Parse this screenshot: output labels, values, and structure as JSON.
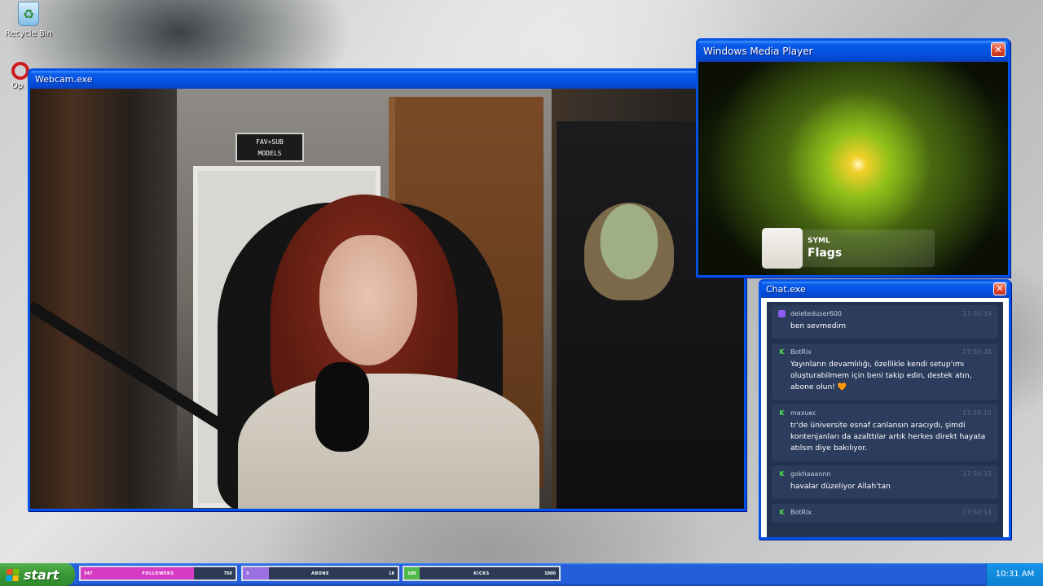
{
  "desktop": {
    "icons": [
      {
        "label": "Recycle Bin"
      },
      {
        "label": "Op"
      }
    ]
  },
  "webcam": {
    "title": "Webcam.exe",
    "sign": [
      "FAV+SUB",
      "MODELS"
    ]
  },
  "mediaplayer": {
    "title": "Windows Media Player",
    "artist": "SYML",
    "track": "Flags",
    "close": "✕"
  },
  "chat": {
    "title": "Chat.exe",
    "close": "✕",
    "messages": [
      {
        "platform": "twitch",
        "user": "deleteduser600",
        "time": "17:50:54",
        "text": "ben sevmedim"
      },
      {
        "platform": "kick",
        "user": "BotRix",
        "time": "17:50:28",
        "text": "Yayınların devamlılığı, özellikle kendi setup'ımı oluşturabilmem için beni takip edin, destek atın, abone olun! 🧡"
      },
      {
        "platform": "kick",
        "user": "maxuec",
        "time": "17:50:15",
        "text": "tr'de üniversite esnaf canlansın aracıydı, şimdi kontenjanları da azalttılar artık herkes direkt hayata atılsın diye bakılıyor."
      },
      {
        "platform": "kick",
        "user": "gokhaaannn",
        "time": "17:50:15",
        "text": "havalar düzeliyor Allah'tan"
      },
      {
        "platform": "kick",
        "user": "BotRix",
        "time": "17:50:14",
        "text": ""
      }
    ]
  },
  "taskbar": {
    "start_label": "start",
    "clock": "10:31 AM",
    "goals": [
      {
        "current": "547",
        "label": "FOLLOWERS",
        "max": "750",
        "progress": 0.73,
        "color": "#d63cc4"
      },
      {
        "current": "3",
        "label": "ABONE",
        "max": "18",
        "progress": 0.17,
        "color": "#9a6fe0"
      },
      {
        "current": "100",
        "label": "KICKS",
        "max": "1000",
        "progress": 0.1,
        "color": "#4fb84a"
      }
    ]
  },
  "colors": {
    "xp_blue": "#0553e6",
    "chat_bg": "#23324f",
    "chat_msg": "#2c3c5d",
    "kick_green": "#4fe04f",
    "twitch_purple": "#8c5cf0"
  }
}
